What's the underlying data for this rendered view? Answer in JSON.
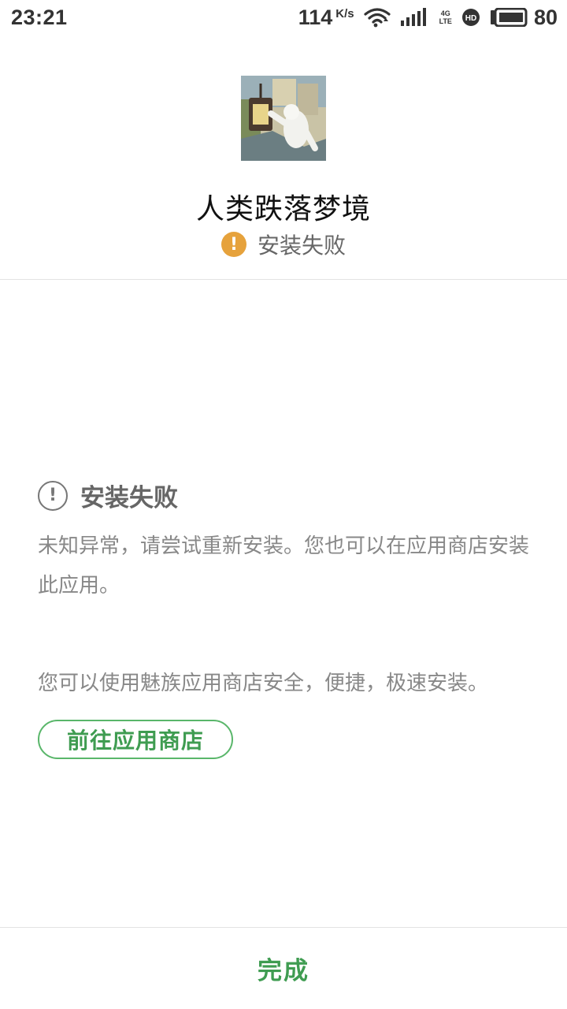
{
  "status_bar": {
    "time": "23:21",
    "speed_value": "114",
    "speed_unit": "K/s",
    "network_type": "4G",
    "network_sub": "LTE",
    "battery_level": "80",
    "icons": [
      "wifi-icon",
      "signal-icon",
      "hd-icon",
      "battery-icon"
    ]
  },
  "header": {
    "app_icon": "game-app-icon",
    "app_name": "人类跌落梦境",
    "status_text": "安装失败",
    "status_icon": "warning-icon",
    "status_color": "#e6a23c"
  },
  "body": {
    "fail_title": "安装失败",
    "fail_description": "未知异常，请尝试重新安装。您也可以在应用商店安装此应用。",
    "store_hint": "您可以使用魅族应用商店安全，便捷，极速安装。",
    "store_button_label": "前往应用商店",
    "accent_color": "#3f9c51"
  },
  "footer": {
    "done_label": "完成"
  }
}
